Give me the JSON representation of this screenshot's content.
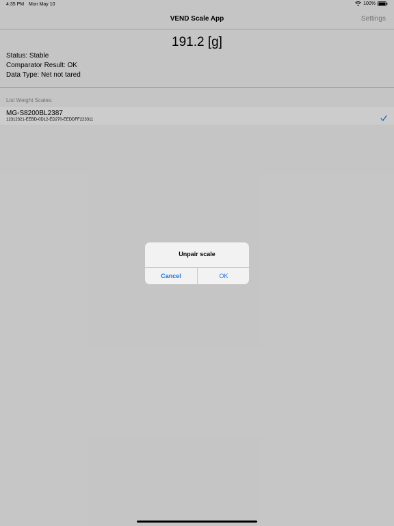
{
  "status_bar": {
    "time": "4:35 PM",
    "date": "Mon May 10",
    "battery": "100%"
  },
  "nav": {
    "title": "VEND Scale App",
    "settings_label": "Settings"
  },
  "weight": {
    "value": "191.2 [g]",
    "status": "Status: Stable",
    "comparator": "Comparator Result: OK",
    "data_type": "Data Type: Net not tared"
  },
  "list": {
    "header": "List Weight Scales:",
    "items": [
      {
        "name": "MG-S8200BL2387",
        "id": "12312321-EEBD-0D12-ED270-EEDDFF223311",
        "selected": true
      }
    ]
  },
  "alert": {
    "title": "Unpair scale",
    "cancel_label": "Cancel",
    "ok_label": "OK"
  },
  "colors": {
    "accent": "#1a73d9",
    "divider": "#c6c6c8",
    "secondary_text": "#8e8e93"
  }
}
